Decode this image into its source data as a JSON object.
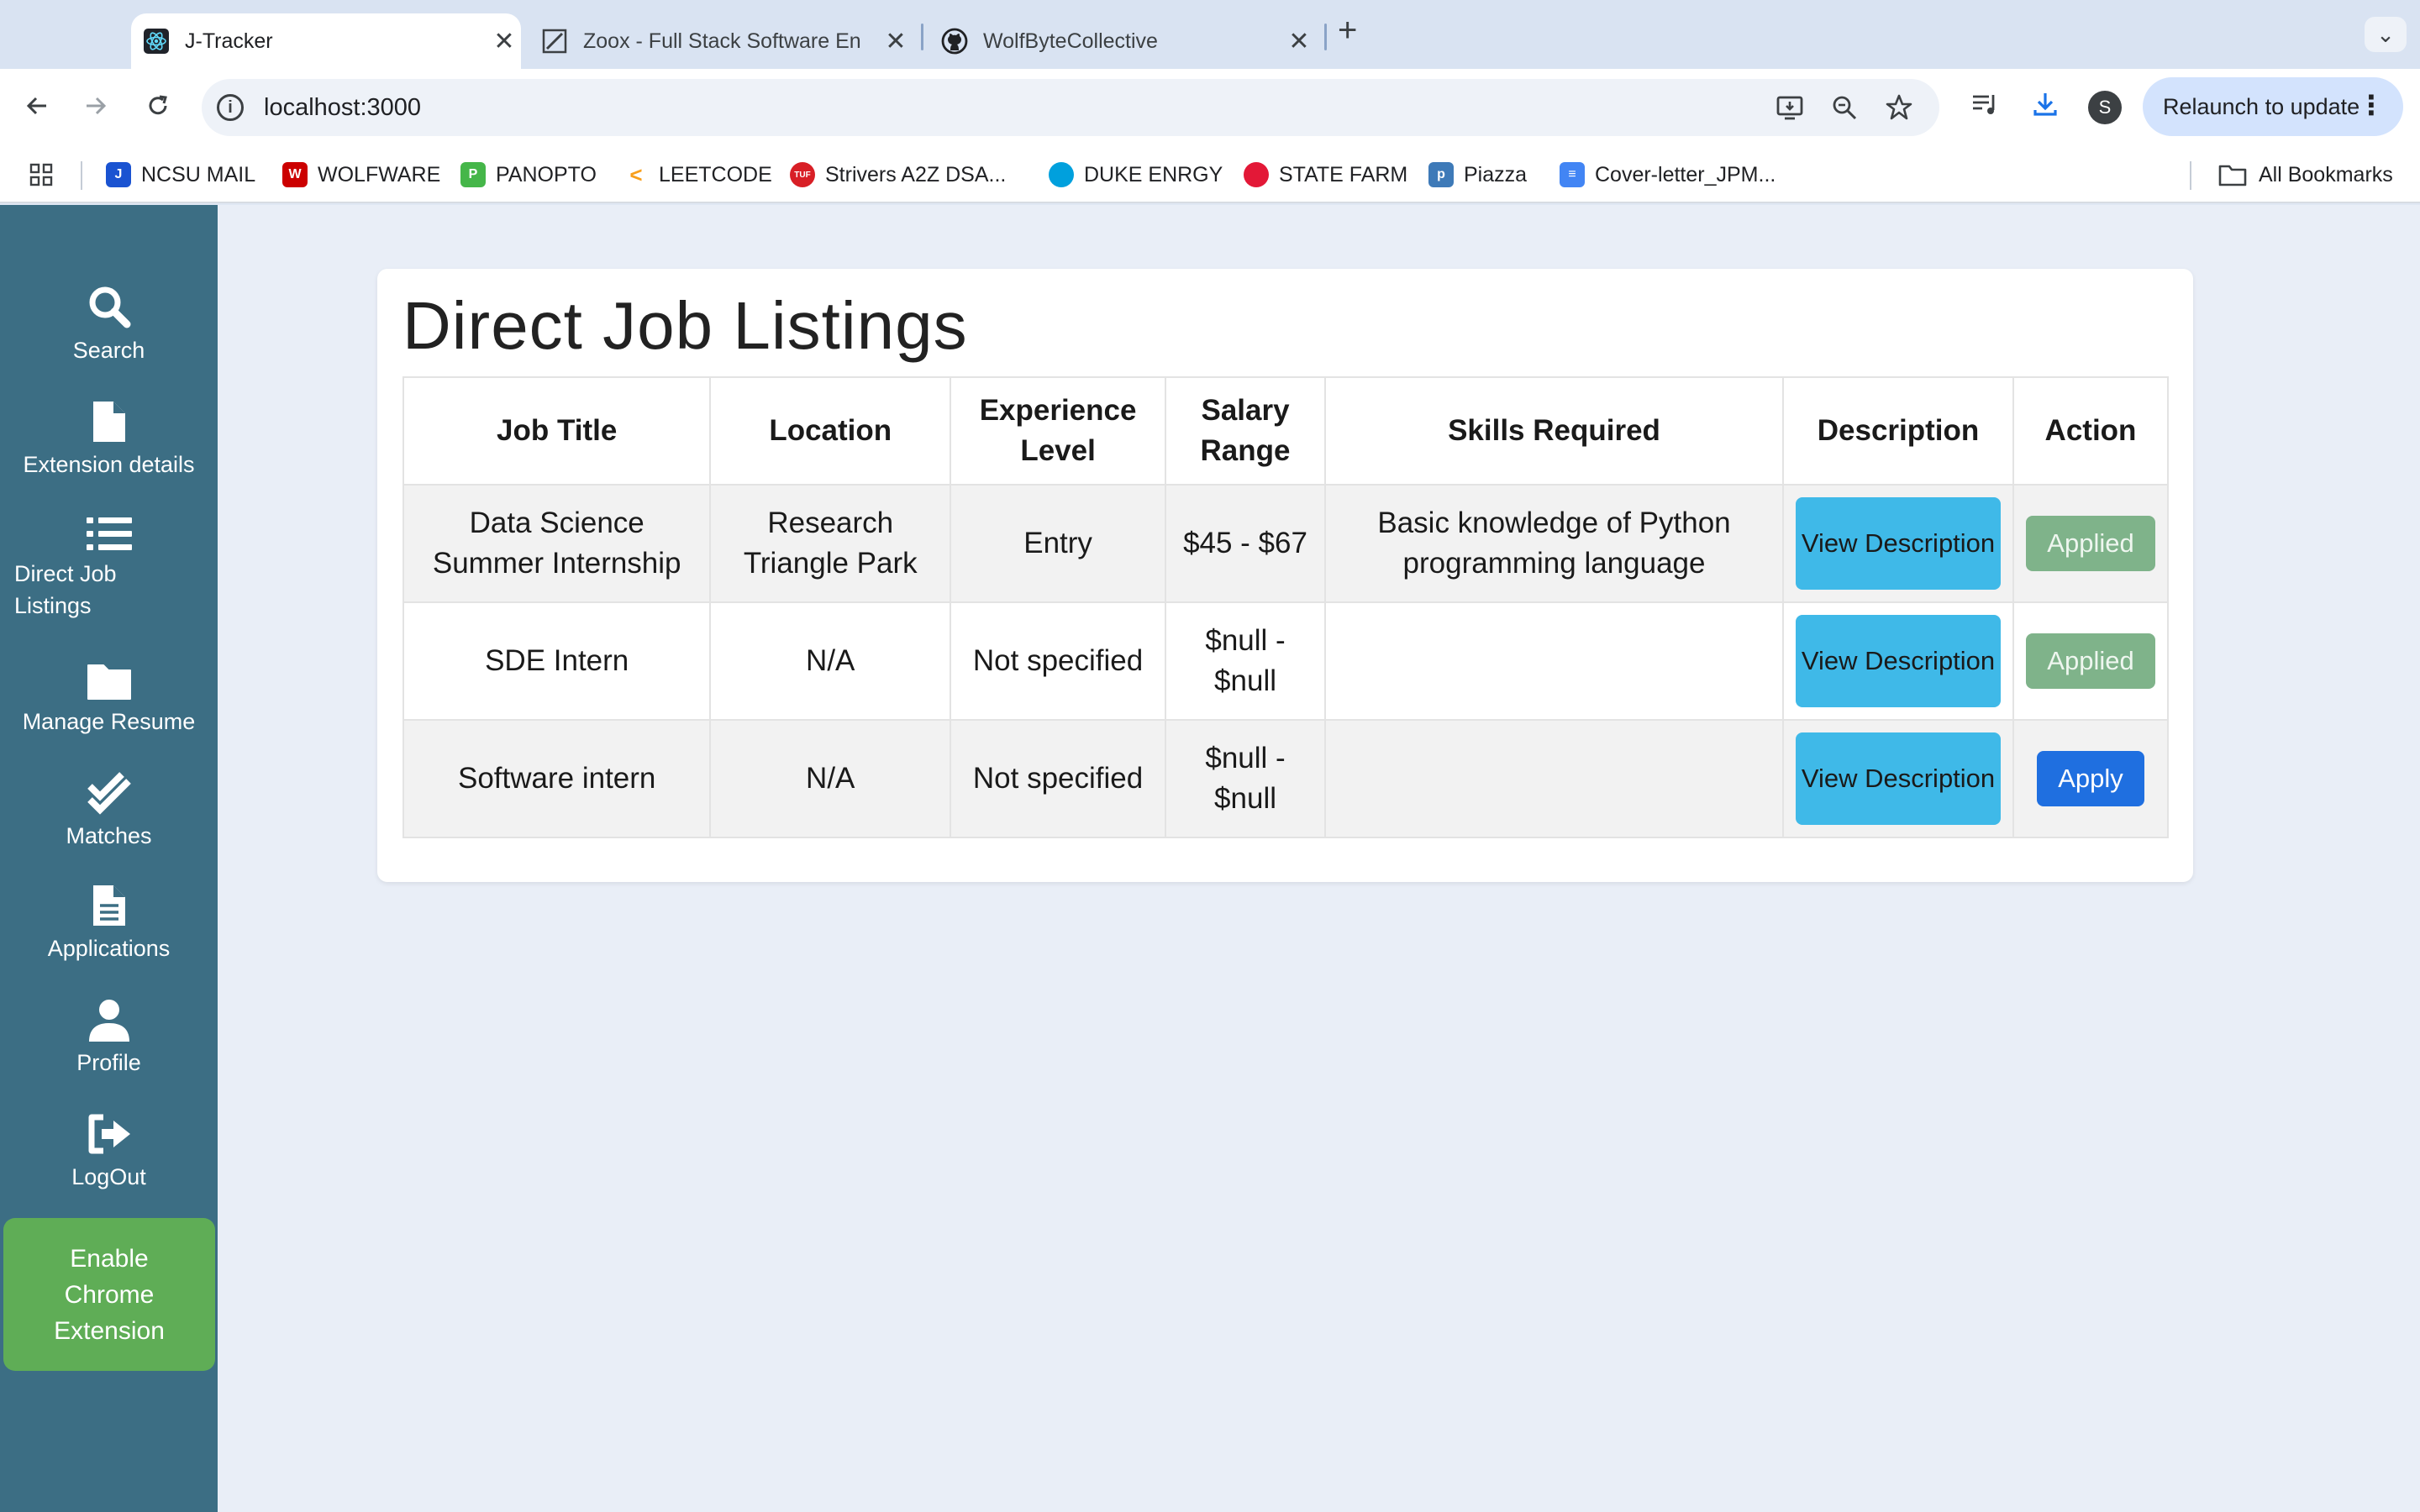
{
  "browser": {
    "tabs": [
      {
        "title": "J-Tracker",
        "icon": "react-icon",
        "active": true
      },
      {
        "title": "Zoox - Full Stack Software En",
        "icon": "zoox-icon",
        "active": false
      },
      {
        "title": "WolfByteCollective",
        "icon": "github-icon",
        "active": false
      }
    ],
    "url": "localhost:3000",
    "relaunch_label": "Relaunch to update",
    "profile_initial": "S",
    "bookmarks": [
      {
        "label": "NCSU MAIL",
        "color": "#1a53d1"
      },
      {
        "label": "WOLFWARE",
        "color": "#cc0000"
      },
      {
        "label": "PANOPTO",
        "color": "#45b649"
      },
      {
        "label": "LEETCODE",
        "color": "#f89f1b"
      },
      {
        "label": "Strivers A2Z DSA...",
        "color": "#d81f26"
      },
      {
        "label": "DUKE ENRGY",
        "color": "#00a0dd"
      },
      {
        "label": "STATE FARM",
        "color": "#e31837"
      },
      {
        "label": "Piazza",
        "color": "#3e7ab8"
      },
      {
        "label": "Cover-letter_JPM...",
        "color": "#4285f4"
      }
    ],
    "all_bookmarks_label": "All Bookmarks"
  },
  "sidebar": {
    "items": [
      {
        "label": "Search",
        "icon": "search-icon"
      },
      {
        "label": "Extension details",
        "icon": "file-icon"
      },
      {
        "label": "Direct Job Listings",
        "icon": "list-icon"
      },
      {
        "label": "Manage Resume",
        "icon": "folder-icon"
      },
      {
        "label": "Matches",
        "icon": "double-check-icon"
      },
      {
        "label": "Applications",
        "icon": "document-icon"
      },
      {
        "label": "Profile",
        "icon": "user-icon"
      },
      {
        "label": "LogOut",
        "icon": "logout-icon"
      }
    ],
    "enable_button": "Enable Chrome Extension"
  },
  "main": {
    "title": "Direct Job Listings",
    "columns": [
      "Job Title",
      "Location",
      "Experience Level",
      "Salary Range",
      "Skills Required",
      "Description",
      "Action"
    ],
    "rows": [
      {
        "title": "Data Science Summer Internship",
        "location": "Research Triangle Park",
        "experience": "Entry",
        "salary": "$45 - $67",
        "skills": "Basic knowledge of Python programming language",
        "description_button": "View Description",
        "action": "Applied"
      },
      {
        "title": "SDE Intern",
        "location": "N/A",
        "experience": "Not specified",
        "salary": "$null - $null",
        "skills": "",
        "description_button": "View Description",
        "action": "Applied"
      },
      {
        "title": "Software intern",
        "location": "N/A",
        "experience": "Not specified",
        "salary": "$null - $null",
        "skills": "",
        "description_button": "View Description",
        "action": "Apply"
      }
    ]
  }
}
